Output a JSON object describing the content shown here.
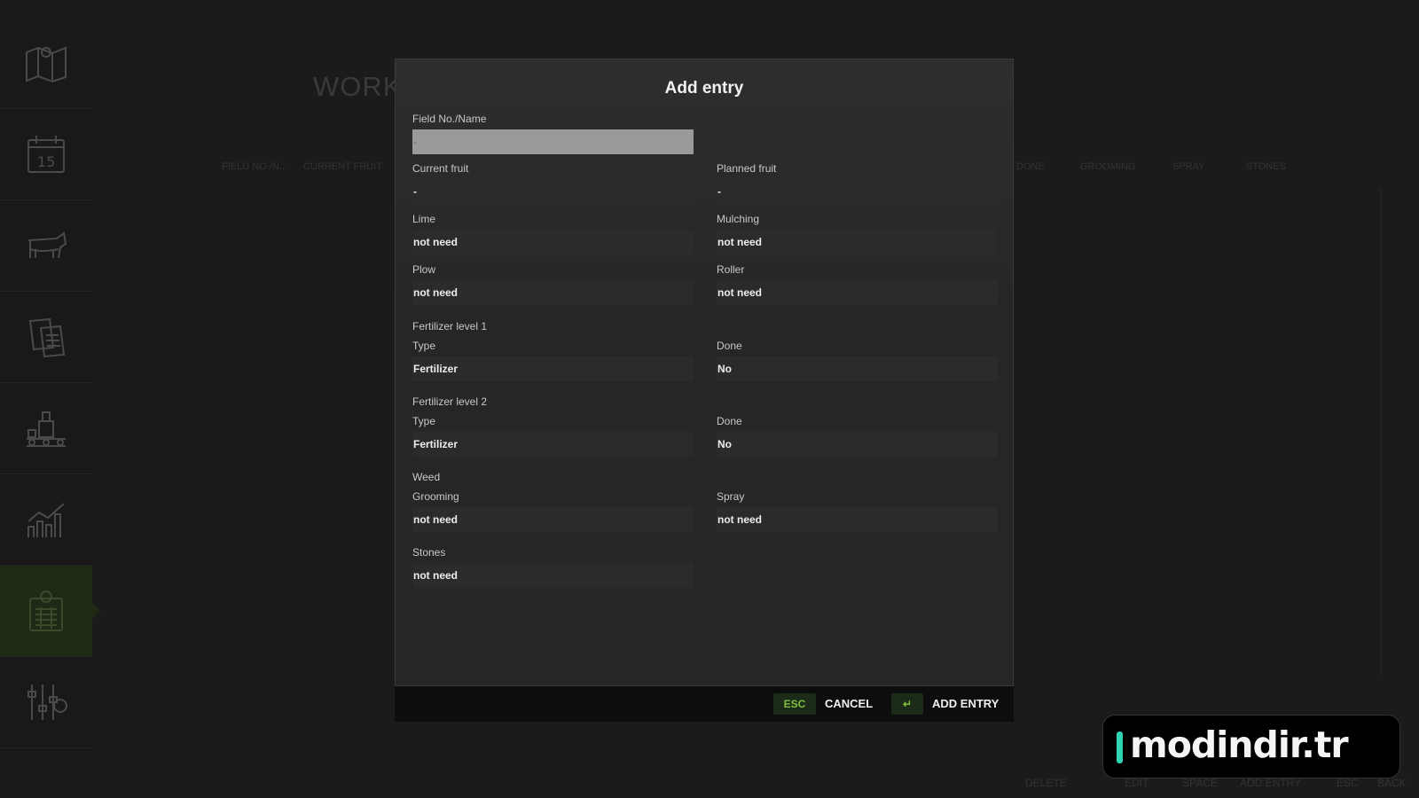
{
  "sidebar": {
    "items": [
      {
        "icon": "map-icon"
      },
      {
        "icon": "calendar-icon",
        "badge": "15"
      },
      {
        "icon": "cow-icon"
      },
      {
        "icon": "documents-icon"
      },
      {
        "icon": "production-icon"
      },
      {
        "icon": "statistics-icon"
      },
      {
        "icon": "field-work-icon",
        "active": true
      },
      {
        "icon": "settings-sliders-icon"
      }
    ]
  },
  "background": {
    "title": "WORK",
    "columns": [
      "FIELD NO./N...",
      "CURRENT FRUIT",
      "DONE",
      "GROOMING",
      "SPRAY",
      "STONES"
    ],
    "footer": [
      "DELETE",
      "EDIT",
      "SPACE",
      "ADD ENTRY",
      "ESC",
      "BACK"
    ]
  },
  "dialog": {
    "title": "Add entry",
    "field_name": {
      "label": "Field No./Name",
      "value": "-"
    },
    "current_fruit": {
      "label": "Current fruit",
      "value": "-"
    },
    "planned_fruit": {
      "label": "Planned fruit",
      "value": "-"
    },
    "lime": {
      "label": "Lime",
      "value": "not need"
    },
    "mulching": {
      "label": "Mulching",
      "value": "not need"
    },
    "plow": {
      "label": "Plow",
      "value": "not need"
    },
    "roller": {
      "label": "Roller",
      "value": "not need"
    },
    "fert1": {
      "heading": "Fertilizer level 1",
      "type_label": "Type",
      "type_value": "Fertilizer",
      "done_label": "Done",
      "done_value": "No"
    },
    "fert2": {
      "heading": "Fertilizer level 2",
      "type_label": "Type",
      "type_value": "Fertilizer",
      "done_label": "Done",
      "done_value": "No"
    },
    "weed": {
      "heading": "Weed",
      "grooming_label": "Grooming",
      "grooming_value": "not need",
      "spray_label": "Spray",
      "spray_value": "not need"
    },
    "stones": {
      "label": "Stones",
      "value": "not need"
    },
    "footer": {
      "esc_key": "ESC",
      "cancel_label": "CANCEL",
      "enter_key": "↵",
      "add_label": "ADD ENTRY"
    }
  },
  "watermark": {
    "text": "modindir.tr"
  },
  "colors": {
    "accent_green": "#7fbf3a",
    "active_sidebar": "#1f2a16",
    "watermark_bar": "#2fd4b3"
  }
}
